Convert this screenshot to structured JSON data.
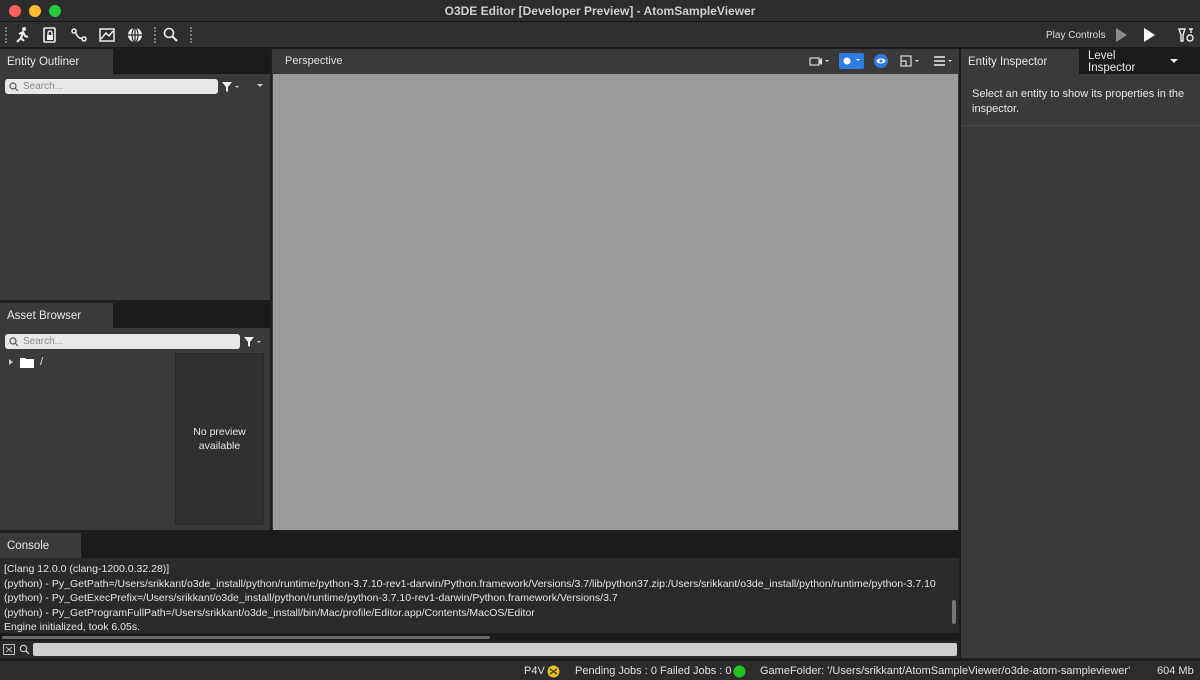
{
  "window": {
    "title": "O3DE Editor [Developer Preview] - AtomSampleViewer"
  },
  "toolbar": {
    "play_controls_label": "Play Controls"
  },
  "entity_outliner": {
    "tab_label": "Entity Outliner",
    "search_placeholder": "Search..."
  },
  "asset_browser": {
    "tab_label": "Asset Browser",
    "search_placeholder": "Search...",
    "tree_root_label": "/",
    "preview_text_line1": "No preview",
    "preview_text_line2": "available"
  },
  "viewport": {
    "tab_label": "Perspective"
  },
  "inspector": {
    "tabs": [
      "Entity Inspector",
      "Level Inspector"
    ],
    "empty_message_line1": "Select an entity to show its properties in the",
    "empty_message_line2": "inspector."
  },
  "console": {
    "tab_label": "Console",
    "lines": [
      "[Clang 12.0.0 (clang-1200.0.32.28)]",
      "(python) - Py_GetPath=/Users/srikkant/o3de_install/python/runtime/python-3.7.10-rev1-darwin/Python.framework/Versions/3.7/lib/python37.zip:/Users/srikkant/o3de_install/python/runtime/python-3.7.10",
      "(python) - Py_GetExecPrefix=/Users/srikkant/o3de_install/python/runtime/python-3.7.10-rev1-darwin/Python.framework/Versions/3.7",
      "(python) - Py_GetProgramFullPath=/Users/srikkant/o3de_install/bin/Mac/profile/Editor.app/Contents/MacOS/Editor",
      "Engine initialized, took 6.05s."
    ]
  },
  "statusbar": {
    "p4v": "P4V",
    "pending_jobs": "Pending Jobs : 0",
    "failed_jobs": "Failed Jobs : 0",
    "game_folder": "GameFolder: '/Users/srikkant/AtomSampleViewer/o3de-atom-sampleviewer'",
    "memory": "604 Mb"
  },
  "colors": {
    "accent_blue": "#2f7de1",
    "status_green": "#22c322",
    "status_yellow": "#e8c21c"
  }
}
